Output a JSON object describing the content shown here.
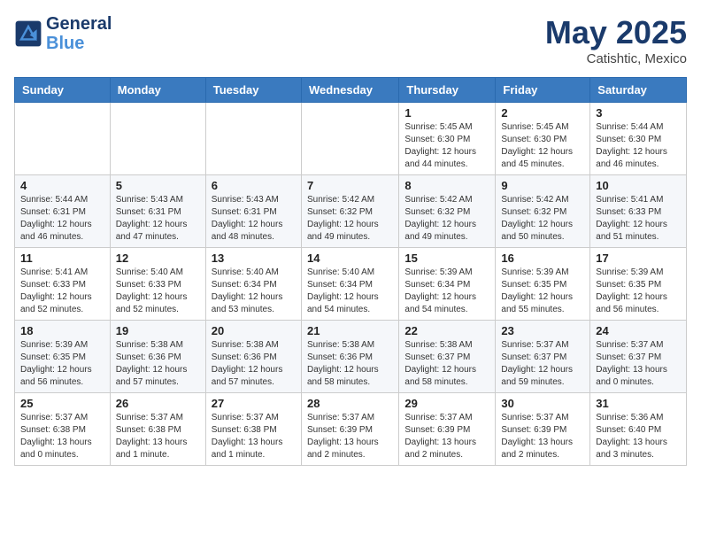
{
  "header": {
    "logo_line1": "General",
    "logo_line2": "Blue",
    "month": "May 2025",
    "location": "Catishtic, Mexico"
  },
  "weekdays": [
    "Sunday",
    "Monday",
    "Tuesday",
    "Wednesday",
    "Thursday",
    "Friday",
    "Saturday"
  ],
  "weeks": [
    [
      {
        "day": "",
        "info": ""
      },
      {
        "day": "",
        "info": ""
      },
      {
        "day": "",
        "info": ""
      },
      {
        "day": "",
        "info": ""
      },
      {
        "day": "1",
        "info": "Sunrise: 5:45 AM\nSunset: 6:30 PM\nDaylight: 12 hours\nand 44 minutes."
      },
      {
        "day": "2",
        "info": "Sunrise: 5:45 AM\nSunset: 6:30 PM\nDaylight: 12 hours\nand 45 minutes."
      },
      {
        "day": "3",
        "info": "Sunrise: 5:44 AM\nSunset: 6:30 PM\nDaylight: 12 hours\nand 46 minutes."
      }
    ],
    [
      {
        "day": "4",
        "info": "Sunrise: 5:44 AM\nSunset: 6:31 PM\nDaylight: 12 hours\nand 46 minutes."
      },
      {
        "day": "5",
        "info": "Sunrise: 5:43 AM\nSunset: 6:31 PM\nDaylight: 12 hours\nand 47 minutes."
      },
      {
        "day": "6",
        "info": "Sunrise: 5:43 AM\nSunset: 6:31 PM\nDaylight: 12 hours\nand 48 minutes."
      },
      {
        "day": "7",
        "info": "Sunrise: 5:42 AM\nSunset: 6:32 PM\nDaylight: 12 hours\nand 49 minutes."
      },
      {
        "day": "8",
        "info": "Sunrise: 5:42 AM\nSunset: 6:32 PM\nDaylight: 12 hours\nand 49 minutes."
      },
      {
        "day": "9",
        "info": "Sunrise: 5:42 AM\nSunset: 6:32 PM\nDaylight: 12 hours\nand 50 minutes."
      },
      {
        "day": "10",
        "info": "Sunrise: 5:41 AM\nSunset: 6:33 PM\nDaylight: 12 hours\nand 51 minutes."
      }
    ],
    [
      {
        "day": "11",
        "info": "Sunrise: 5:41 AM\nSunset: 6:33 PM\nDaylight: 12 hours\nand 52 minutes."
      },
      {
        "day": "12",
        "info": "Sunrise: 5:40 AM\nSunset: 6:33 PM\nDaylight: 12 hours\nand 52 minutes."
      },
      {
        "day": "13",
        "info": "Sunrise: 5:40 AM\nSunset: 6:34 PM\nDaylight: 12 hours\nand 53 minutes."
      },
      {
        "day": "14",
        "info": "Sunrise: 5:40 AM\nSunset: 6:34 PM\nDaylight: 12 hours\nand 54 minutes."
      },
      {
        "day": "15",
        "info": "Sunrise: 5:39 AM\nSunset: 6:34 PM\nDaylight: 12 hours\nand 54 minutes."
      },
      {
        "day": "16",
        "info": "Sunrise: 5:39 AM\nSunset: 6:35 PM\nDaylight: 12 hours\nand 55 minutes."
      },
      {
        "day": "17",
        "info": "Sunrise: 5:39 AM\nSunset: 6:35 PM\nDaylight: 12 hours\nand 56 minutes."
      }
    ],
    [
      {
        "day": "18",
        "info": "Sunrise: 5:39 AM\nSunset: 6:35 PM\nDaylight: 12 hours\nand 56 minutes."
      },
      {
        "day": "19",
        "info": "Sunrise: 5:38 AM\nSunset: 6:36 PM\nDaylight: 12 hours\nand 57 minutes."
      },
      {
        "day": "20",
        "info": "Sunrise: 5:38 AM\nSunset: 6:36 PM\nDaylight: 12 hours\nand 57 minutes."
      },
      {
        "day": "21",
        "info": "Sunrise: 5:38 AM\nSunset: 6:36 PM\nDaylight: 12 hours\nand 58 minutes."
      },
      {
        "day": "22",
        "info": "Sunrise: 5:38 AM\nSunset: 6:37 PM\nDaylight: 12 hours\nand 58 minutes."
      },
      {
        "day": "23",
        "info": "Sunrise: 5:37 AM\nSunset: 6:37 PM\nDaylight: 12 hours\nand 59 minutes."
      },
      {
        "day": "24",
        "info": "Sunrise: 5:37 AM\nSunset: 6:37 PM\nDaylight: 13 hours\nand 0 minutes."
      }
    ],
    [
      {
        "day": "25",
        "info": "Sunrise: 5:37 AM\nSunset: 6:38 PM\nDaylight: 13 hours\nand 0 minutes."
      },
      {
        "day": "26",
        "info": "Sunrise: 5:37 AM\nSunset: 6:38 PM\nDaylight: 13 hours\nand 1 minute."
      },
      {
        "day": "27",
        "info": "Sunrise: 5:37 AM\nSunset: 6:38 PM\nDaylight: 13 hours\nand 1 minute."
      },
      {
        "day": "28",
        "info": "Sunrise: 5:37 AM\nSunset: 6:39 PM\nDaylight: 13 hours\nand 2 minutes."
      },
      {
        "day": "29",
        "info": "Sunrise: 5:37 AM\nSunset: 6:39 PM\nDaylight: 13 hours\nand 2 minutes."
      },
      {
        "day": "30",
        "info": "Sunrise: 5:37 AM\nSunset: 6:39 PM\nDaylight: 13 hours\nand 2 minutes."
      },
      {
        "day": "31",
        "info": "Sunrise: 5:36 AM\nSunset: 6:40 PM\nDaylight: 13 hours\nand 3 minutes."
      }
    ]
  ]
}
